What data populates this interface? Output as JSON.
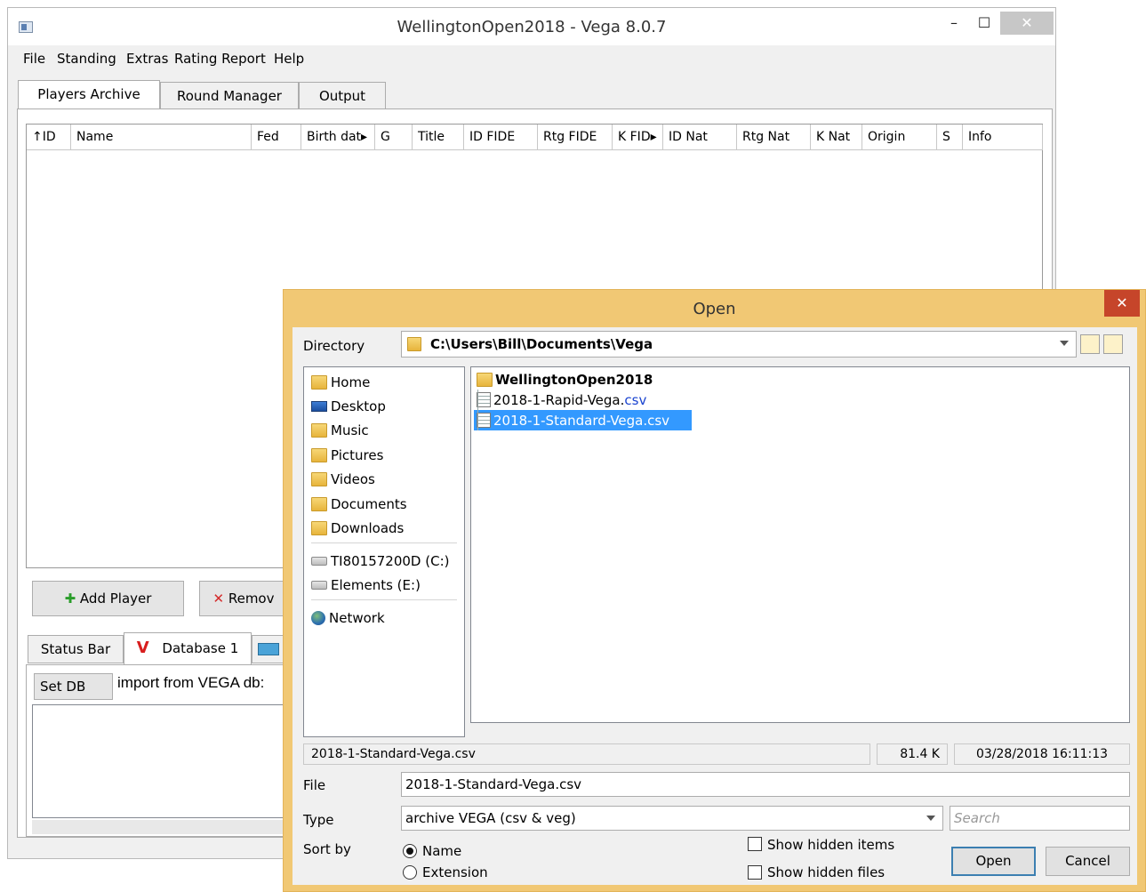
{
  "window": {
    "title": "WellingtonOpen2018 - Vega 8.0.7",
    "minimize": "–",
    "maximize": "☐",
    "close": "✕"
  },
  "menu": [
    "File",
    "Standing",
    "Extras",
    "Rating Report",
    "Help"
  ],
  "tabs": [
    "Players Archive",
    "Round Manager",
    "Output"
  ],
  "columns": [
    "↑ID",
    "Name",
    "Fed",
    "Birth dat▸",
    "G",
    "Title",
    "ID FIDE",
    "Rtg FIDE",
    "K FID▸",
    "ID Nat",
    "Rtg Nat",
    "K Nat",
    "Origin",
    "S",
    "Info"
  ],
  "buttons": {
    "add_player": "Add Player",
    "remove": "Remov",
    "add_icon": "✚",
    "remove_icon": "✕"
  },
  "bottom_tabs": {
    "status_bar": "Status Bar",
    "database": "Database 1",
    "vega_logo": "V"
  },
  "db_panel": {
    "set_db": "Set DB",
    "import_label": "import from VEGA db:"
  },
  "dialog": {
    "title": "Open",
    "close": "✕",
    "directory_label": "Directory",
    "directory_path": "C:\\Users\\Bill\\Documents\\Vega",
    "sidebar": {
      "places": [
        {
          "label": "Home",
          "icon": "home-folder-icon"
        },
        {
          "label": "Desktop",
          "icon": "desktop-icon"
        },
        {
          "label": "Music",
          "icon": "music-folder-icon"
        },
        {
          "label": "Pictures",
          "icon": "pictures-folder-icon"
        },
        {
          "label": "Videos",
          "icon": "videos-folder-icon"
        },
        {
          "label": "Documents",
          "icon": "documents-folder-icon"
        },
        {
          "label": "Downloads",
          "icon": "downloads-folder-icon"
        }
      ],
      "drives": [
        {
          "label": "TI80157200D (C:)",
          "icon": "drive-icon"
        },
        {
          "label": "Elements (E:)",
          "icon": "drive-icon"
        }
      ],
      "network": {
        "label": "Network",
        "icon": "network-icon"
      }
    },
    "files": [
      {
        "name": "WellingtonOpen2018",
        "ext": "",
        "type": "folder",
        "selected": false
      },
      {
        "name": "2018-1-Rapid-Vega.",
        "ext": "csv",
        "type": "csv",
        "selected": false
      },
      {
        "name": "2018-1-Standard-Vega.",
        "ext": "csv",
        "type": "csv",
        "selected": true
      }
    ],
    "status": {
      "filename": "2018-1-Standard-Vega.csv",
      "size": "81.4 K",
      "modified": "03/28/2018 16:11:13"
    },
    "file_label": "File",
    "file_value": "2018-1-Standard-Vega.csv",
    "type_label": "Type",
    "type_value": "archive VEGA (csv & veg)",
    "search_placeholder": "Search",
    "sort_label": "Sort by",
    "sort_options": [
      "Name",
      "Extension"
    ],
    "sort_selected": "Name",
    "show_hidden_items": "Show hidden items",
    "show_hidden_files": "Show hidden files",
    "open_button": "Open",
    "cancel_button": "Cancel"
  },
  "colors": {
    "dialog_frame": "#f1c874",
    "selection": "#3399ff",
    "dialog_close": "#c6452a",
    "add_green": "#2a9d2a",
    "remove_red": "#d42a2a",
    "vega_red": "#d81e1e"
  }
}
